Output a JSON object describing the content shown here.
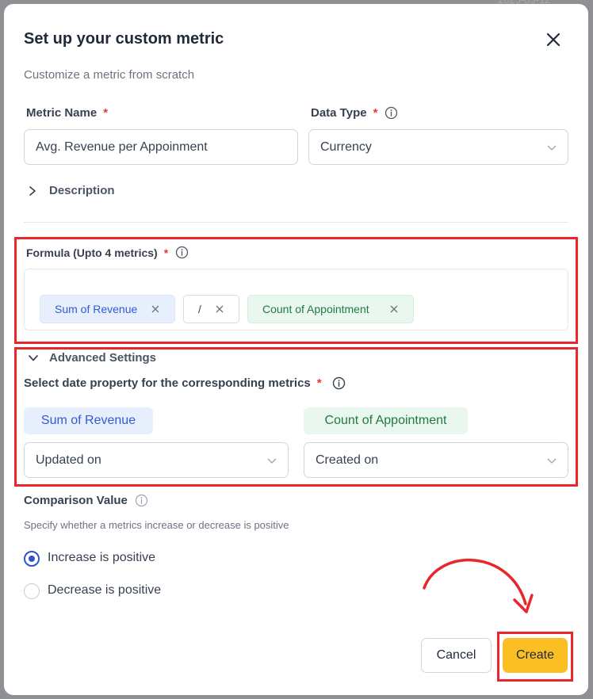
{
  "background": {
    "date_fragment": "2023-05-12"
  },
  "dialog": {
    "title": "Set up your custom metric",
    "subtitle": "Customize a metric from scratch"
  },
  "metric_name": {
    "label": "Metric Name",
    "required_mark": "*",
    "value": "Avg. Revenue per Appoinment"
  },
  "data_type": {
    "label": "Data Type",
    "required_mark": "*",
    "value": "Currency"
  },
  "description": {
    "label": "Description"
  },
  "formula": {
    "label": "Formula (Upto 4 metrics)",
    "required_mark": "*",
    "chips": [
      {
        "label": "Sum of Revenue"
      },
      {
        "label": "/"
      },
      {
        "label": "Count of Appointment"
      }
    ]
  },
  "advanced": {
    "label": "Advanced Settings",
    "date_property_label": "Select date property for the corresponding metrics",
    "required_mark": "*",
    "metrics": [
      {
        "tag": "Sum of Revenue",
        "date_value": "Updated on"
      },
      {
        "tag": "Count of Appointment",
        "date_value": "Created on"
      }
    ]
  },
  "comparison": {
    "label": "Comparison Value",
    "help": "Specify whether a metrics increase or decrease is positive",
    "options": [
      {
        "label": "Increase is positive",
        "selected": true
      },
      {
        "label": "Decrease is positive",
        "selected": false
      }
    ]
  },
  "footer": {
    "cancel_label": "Cancel",
    "create_label": "Create"
  },
  "colors": {
    "accent": "#fbbf24",
    "highlight": "#e8262b",
    "radio_selected": "#2f55c8",
    "chip_blue": "#2f5bd6",
    "chip_green": "#1f7a44"
  },
  "icons": [
    "close-icon",
    "info-icon",
    "chevron-down-icon",
    "chevron-right-icon",
    "remove-x-icon",
    "curved-arrow"
  ]
}
